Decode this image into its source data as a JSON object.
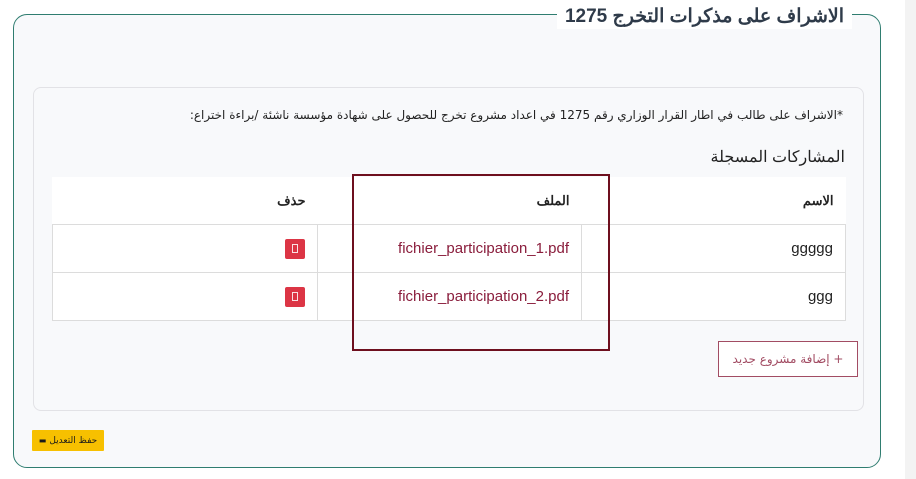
{
  "form": {
    "title": "الاشراف على مذكرات التخرج 1275",
    "description": "*الاشراف على طالب في اطار القرار الوزاري رقم 1275 في اعداد مشروع تخرج للحصول على شهادة مؤسسة ناشئة /براءة اختراع:",
    "section_title": "المشاركات المسجلة",
    "table": {
      "headers": {
        "name": "الاسم",
        "file": "الملف",
        "delete": "حذف"
      },
      "rows": [
        {
          "name": "ggggg",
          "file": "fichier_participation_1.pdf"
        },
        {
          "name": "ggg",
          "file": "fichier_participation_2.pdf"
        }
      ]
    },
    "add_button_label": "+ إضافة مشروع جديد",
    "save_button_label": "حفظ التعديل",
    "save_icon": "save-icon"
  },
  "colors": {
    "border": "#2f7d70",
    "link": "#8a1d3c",
    "delete": "#dc3545",
    "save": "#f7c000",
    "highlight": "#6e0f1e"
  }
}
